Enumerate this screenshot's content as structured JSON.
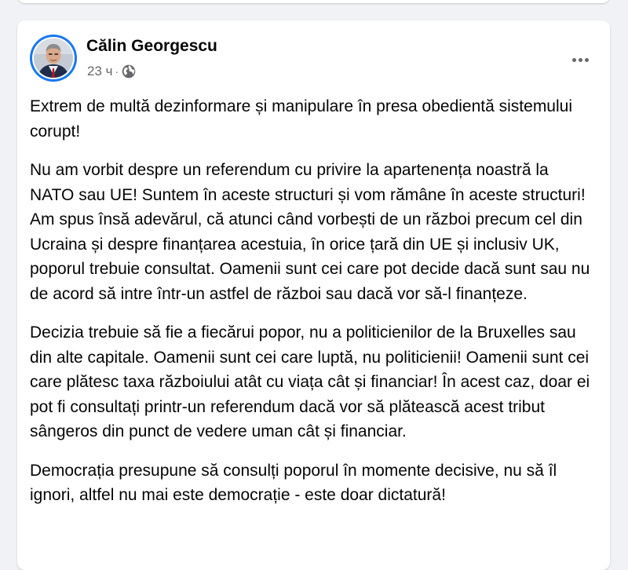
{
  "post": {
    "author": "Călin Georgescu",
    "timestamp": "23 ч",
    "separator": "·",
    "privacy_icon": "globe-icon",
    "more_icon": "more-options-icon",
    "accent_color": "#1877f2",
    "paragraphs": [
      "Extrem de multă dezinformare și manipulare în presa obedientă sistemului corupt!",
      "Nu am vorbit despre un referendum cu privire la apartenența noastră la NATO sau UE! Suntem în aceste structuri și vom rămâne în aceste structuri! Am spus însă adevărul, că atunci când vorbești de un război precum cel din Ucraina și despre finanțarea acestuia, în orice țară din UE și inclusiv UK, poporul trebuie consultat. Oamenii sunt cei care pot decide dacă sunt sau nu de acord să intre într-un astfel de război sau dacă vor să-l finanțeze.",
      "Decizia trebuie să fie a fiecărui popor, nu a politicienilor de la Bruxelles sau din alte capitale. Oamenii sunt cei care luptă, nu politicienii! Oamenii sunt cei care plătesc taxa războiului atât cu viața cât și financiar! În acest caz, doar ei pot fi consultați printr-un referendum dacă vor să plătească acest tribut sângeros din punct de vedere uman cât și financiar.",
      "Democrația presupune să consulți poporul în momente decisive, nu să îl ignori, altfel nu mai este democrație - este doar dictatură!"
    ]
  }
}
